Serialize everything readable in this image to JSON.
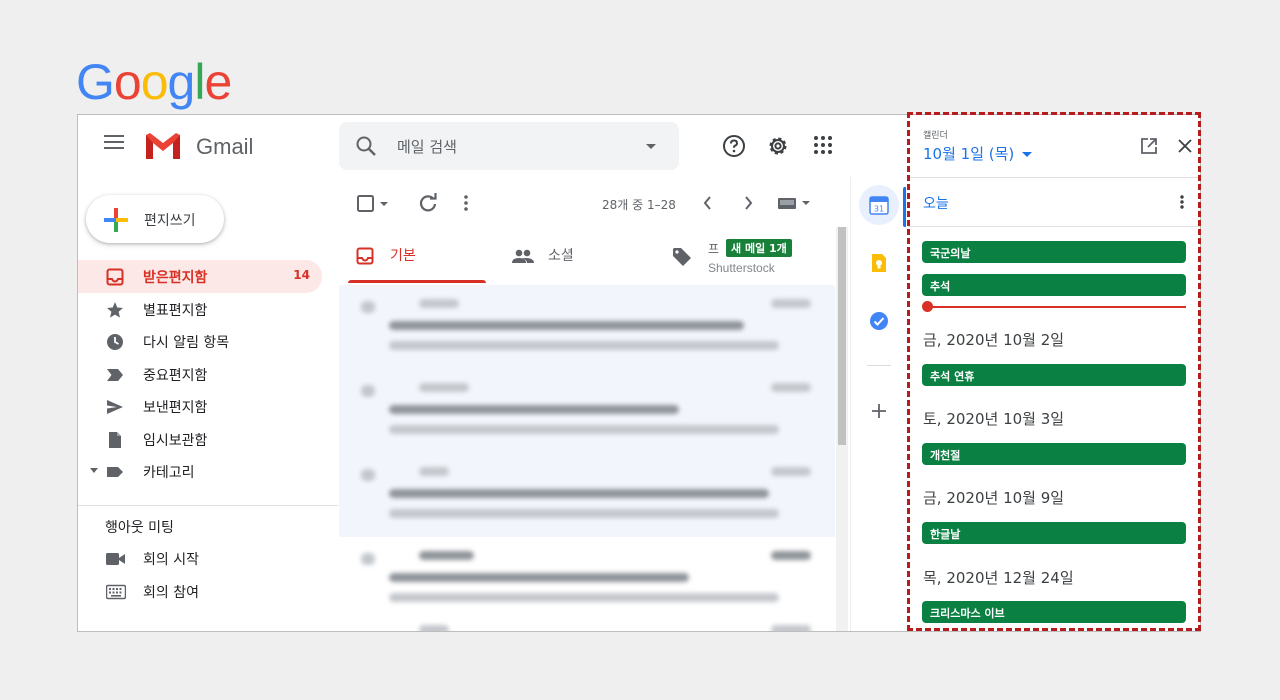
{
  "logo": {
    "letters": [
      "G",
      "o",
      "o",
      "g",
      "l",
      "e"
    ],
    "colors": [
      "#4285F4",
      "#EA4335",
      "#FBBC05",
      "#4285F4",
      "#34A853",
      "#EA4335"
    ]
  },
  "header": {
    "app_name": "Gmail",
    "search_placeholder": "메일 검색"
  },
  "compose": {
    "label": "편지쓰기"
  },
  "sidebar": {
    "items": [
      {
        "label": "받은편지함",
        "count": "14",
        "icon": "inbox-icon",
        "active": true
      },
      {
        "label": "별표편지함",
        "count": "",
        "icon": "star-icon"
      },
      {
        "label": "다시 알림 항목",
        "count": "",
        "icon": "clock-icon"
      },
      {
        "label": "중요편지함",
        "count": "",
        "icon": "important-icon"
      },
      {
        "label": "보낸편지함",
        "count": "",
        "icon": "send-icon"
      },
      {
        "label": "임시보관함",
        "count": "",
        "icon": "draft-icon"
      },
      {
        "label": "카테고리",
        "count": "",
        "icon": "label-icon"
      }
    ]
  },
  "hangouts": {
    "title": "행아웃 미팅",
    "start": "회의 시작",
    "join": "회의 참여"
  },
  "toolbar": {
    "page_info": "28개 중 1–28"
  },
  "tabs": [
    {
      "label": "기본",
      "icon": "inbox-icon",
      "active": true
    },
    {
      "label": "소셜",
      "icon": "people-icon"
    }
  ],
  "promo_tab": {
    "title": "프",
    "badge": "새 메일 1개",
    "sender": "Shutterstock"
  },
  "calendar": {
    "header_label": "캘린더",
    "date": "10월 1일 (목)",
    "today_label": "오늘",
    "events_today": [
      "국군의날",
      "추석"
    ],
    "days": [
      {
        "heading": "금, 2020년 10월 2일",
        "event": "추석 연휴"
      },
      {
        "heading": "토, 2020년 10월 3일",
        "event": "개천절"
      },
      {
        "heading": "금, 2020년 10월 9일",
        "event": "한글날"
      },
      {
        "heading": "목, 2020년 12월 24일",
        "event": "크리스마스 이브"
      }
    ],
    "event_color": "#0b8043",
    "accent_color": "#1a73e8"
  }
}
